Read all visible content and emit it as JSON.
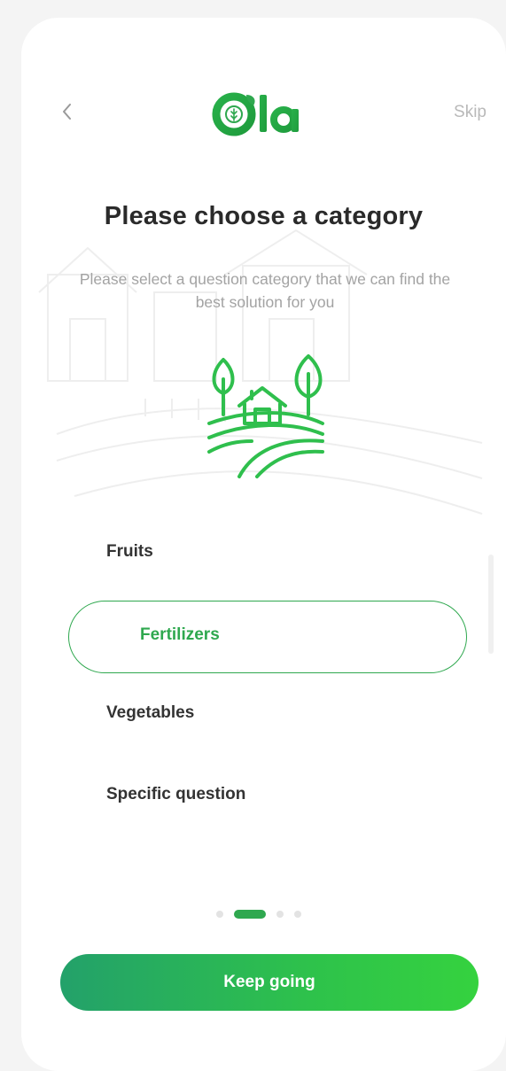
{
  "header": {
    "back_icon": "chevron-left-icon",
    "brand_name": "Ola",
    "skip_label": "Skip"
  },
  "content": {
    "title": "Please choose a category",
    "subtitle": "Please select a question category that we can find the best solution for you",
    "illustration": "farm-icon",
    "background_illustration": "farm-scene"
  },
  "categories": [
    {
      "label": "Fruits",
      "selected": false
    },
    {
      "label": "Fertilizers",
      "selected": true
    },
    {
      "label": "Vegetables",
      "selected": false
    },
    {
      "label": "Specific question",
      "selected": false
    }
  ],
  "pagination": {
    "total": 4,
    "active_index": 1
  },
  "cta": {
    "label": "Keep going"
  },
  "colors": {
    "accent": "#2fa84f",
    "text": "#333333",
    "muted": "#a3a3a3",
    "background": "#f4f4f4",
    "card": "#ffffff"
  }
}
